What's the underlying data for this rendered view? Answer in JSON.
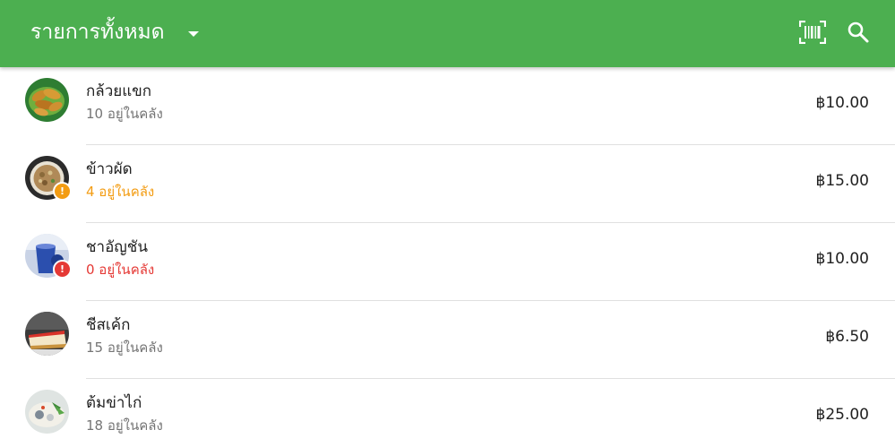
{
  "appbar": {
    "title": "รายการทั้งหมด",
    "color": "#4caf50"
  },
  "items": [
    {
      "name": "กล้วยแขก",
      "stock": "10 อยู่ในคลัง",
      "price": "฿10.00",
      "stock_status": "normal",
      "image": "fried-banana"
    },
    {
      "name": "ข้าวผัด",
      "stock": "4 อยู่ในคลัง",
      "price": "฿15.00",
      "stock_status": "low",
      "image": "fried-rice"
    },
    {
      "name": "ชาอัญชัน",
      "stock": "0 อยู่ในคลัง",
      "price": "฿10.00",
      "stock_status": "out",
      "image": "butterfly-pea-tea"
    },
    {
      "name": "ชีสเค้ก",
      "stock": "15 อยู่ในคลัง",
      "price": "฿6.50",
      "stock_status": "normal",
      "image": "cheesecake"
    },
    {
      "name": "ต้มข่าไก่",
      "stock": "18 อยู่ในคลัง",
      "price": "฿25.00",
      "stock_status": "normal",
      "image": "tom-kha-gai"
    }
  ],
  "status_colors": {
    "normal": "#757575",
    "low": "#f39c12",
    "out": "#e53935"
  }
}
